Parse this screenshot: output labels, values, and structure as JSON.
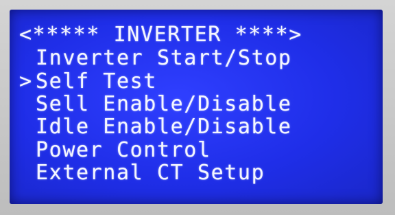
{
  "screen": {
    "title": "<***** INVERTER ****>",
    "cursor_symbol": ">",
    "menu_items": [
      {
        "label": "Inverter Start/Stop",
        "selected": false
      },
      {
        "label": "Self Test",
        "selected": true
      },
      {
        "label": "Sell Enable/Disable",
        "selected": false
      },
      {
        "label": "Idle Enable/Disable",
        "selected": false
      },
      {
        "label": "Power Control",
        "selected": false
      },
      {
        "label": "External CT Setup",
        "selected": false
      }
    ],
    "colors": {
      "background": "#1f2ee8",
      "text": "#f4f6ff",
      "bezel": "#c9c9c9"
    }
  }
}
